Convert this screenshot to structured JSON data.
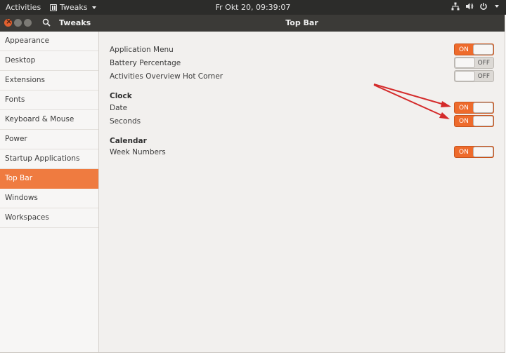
{
  "panel": {
    "activities": "Activities",
    "app_menu": "Tweaks",
    "clock": "Fr Okt 20, 09:39:07",
    "tray_icons": [
      "network-icon",
      "volume-icon",
      "power-icon"
    ]
  },
  "window": {
    "app_name": "Tweaks",
    "title": "Top Bar"
  },
  "sidebar": {
    "items": [
      {
        "label": "Appearance"
      },
      {
        "label": "Desktop"
      },
      {
        "label": "Extensions"
      },
      {
        "label": "Fonts"
      },
      {
        "label": "Keyboard & Mouse"
      },
      {
        "label": "Power"
      },
      {
        "label": "Startup Applications"
      },
      {
        "label": "Top Bar"
      },
      {
        "label": "Windows"
      },
      {
        "label": "Workspaces"
      }
    ],
    "active": "Top Bar"
  },
  "settings": {
    "application_menu": {
      "label": "Application Menu",
      "state": "ON"
    },
    "battery_percentage": {
      "label": "Battery Percentage",
      "state": "OFF"
    },
    "hot_corner": {
      "label": "Activities Overview Hot Corner",
      "state": "OFF"
    },
    "clock_heading": "Clock",
    "date": {
      "label": "Date",
      "state": "ON"
    },
    "seconds": {
      "label": "Seconds",
      "state": "ON"
    },
    "calendar_heading": "Calendar",
    "week_numbers": {
      "label": "Week Numbers",
      "state": "ON"
    }
  },
  "colors": {
    "accent": "#ef7b40",
    "switch_on": "#ee6b2c",
    "annotation_arrow": "#d42a2a",
    "panel_bg": "#2c2c2a",
    "headerbar_bg": "#3b3a37"
  }
}
